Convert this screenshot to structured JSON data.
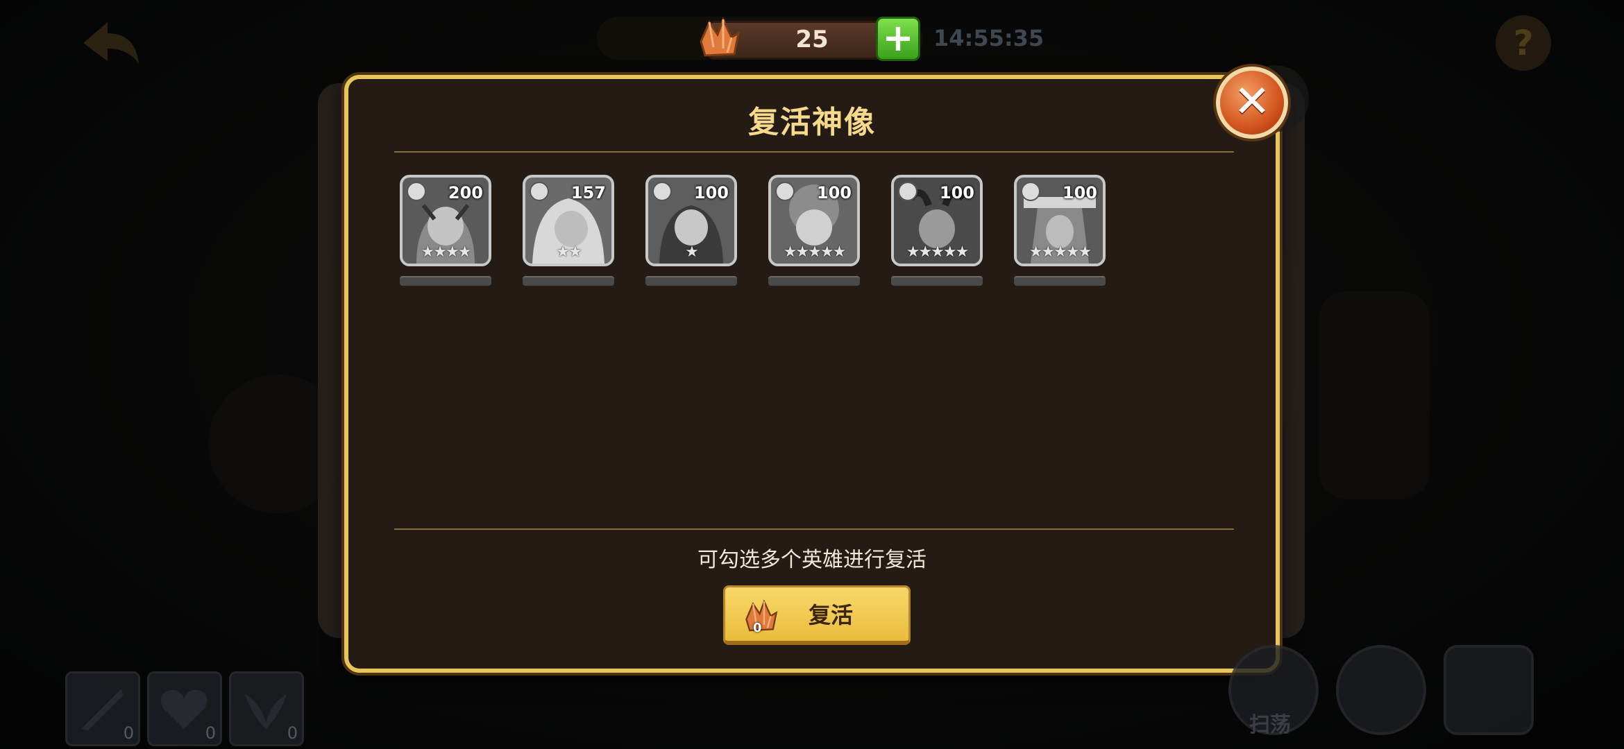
{
  "top_bar": {
    "currency_value": "25",
    "plus_label": "+",
    "timer": "14:55:35",
    "help_label": "?"
  },
  "dialog": {
    "title": "复活神像",
    "close_label": "✕",
    "hint": "可勾选多个英雄进行复活",
    "revive_button": {
      "label": "复活",
      "cost": "0"
    }
  },
  "heroes": [
    {
      "count": "200",
      "stars": "★★★★",
      "faction": "leaf-faction-icon"
    },
    {
      "count": "157",
      "stars": "★★",
      "faction": "skull-faction-icon"
    },
    {
      "count": "100",
      "stars": "★",
      "faction": "swirl-faction-icon"
    },
    {
      "count": "100",
      "stars": "★★★★★",
      "faction": "leaf-faction-icon"
    },
    {
      "count": "100",
      "stars": "★★★★★",
      "faction": "swirl-faction-icon"
    },
    {
      "count": "100",
      "stars": "★★★★★",
      "faction": "cross-faction-icon"
    }
  ],
  "bottom_left": {
    "slot_counts": [
      "0",
      "0",
      "0"
    ]
  },
  "bottom_right": {
    "sweep_label": "扫荡"
  },
  "colors": {
    "accent_gold": "#e8c55c",
    "title_gold": "#f6d98a",
    "button_yellow": "#f8d86a",
    "close_orange": "#d3541e",
    "plus_green": "#3aa11c",
    "panel_bg": "#231b14"
  }
}
